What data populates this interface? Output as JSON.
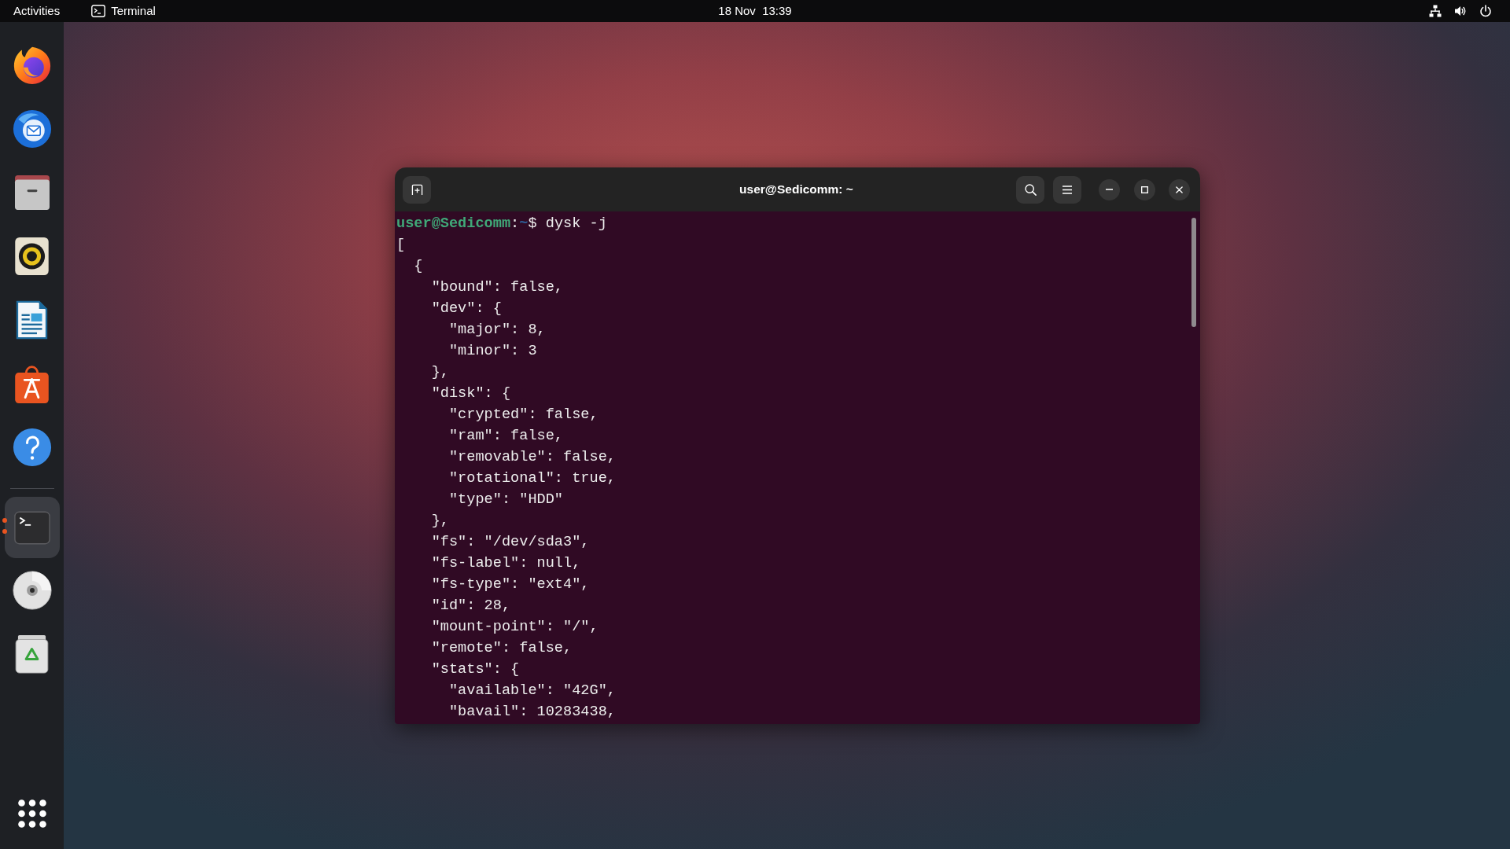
{
  "top_bar": {
    "activities": "Activities",
    "app_menu": "Terminal",
    "clock": "18 Nov  13:39"
  },
  "dock": {
    "pinned": [
      {
        "kind": "browser",
        "active": false
      },
      {
        "kind": "mail",
        "active": false
      },
      {
        "kind": "files",
        "active": false
      },
      {
        "kind": "music",
        "active": false
      },
      {
        "kind": "writer",
        "active": false
      },
      {
        "kind": "store",
        "active": false
      },
      {
        "kind": "help",
        "active": false
      }
    ],
    "other": [
      {
        "kind": "terminal",
        "active": true
      },
      {
        "kind": "disc",
        "active": false
      },
      {
        "kind": "trash",
        "active": false
      }
    ]
  },
  "terminal": {
    "title": "user@Sedicomm: ~",
    "prompt": [
      {
        "kind": "user",
        "text": "user@Sedicomm"
      },
      {
        "kind": "plain",
        "text": ":"
      },
      {
        "kind": "path",
        "text": "~"
      },
      {
        "kind": "plain",
        "text": "$ dysk -j"
      }
    ],
    "lines": [
      "[",
      "  {",
      "    \"bound\": false,",
      "    \"dev\": {",
      "      \"major\": 8,",
      "      \"minor\": 3",
      "    },",
      "    \"disk\": {",
      "      \"crypted\": false,",
      "      \"ram\": false,",
      "      \"removable\": false,",
      "      \"rotational\": true,",
      "      \"type\": \"HDD\"",
      "    },",
      "    \"fs\": \"/dev/sda3\",",
      "    \"fs-label\": null,",
      "    \"fs-type\": \"ext4\",",
      "    \"id\": 28,",
      "    \"mount-point\": \"/\",",
      "    \"remote\": false,",
      "    \"stats\": {",
      "      \"available\": \"42G\",",
      "      \"bavail\": 10283438,"
    ]
  }
}
